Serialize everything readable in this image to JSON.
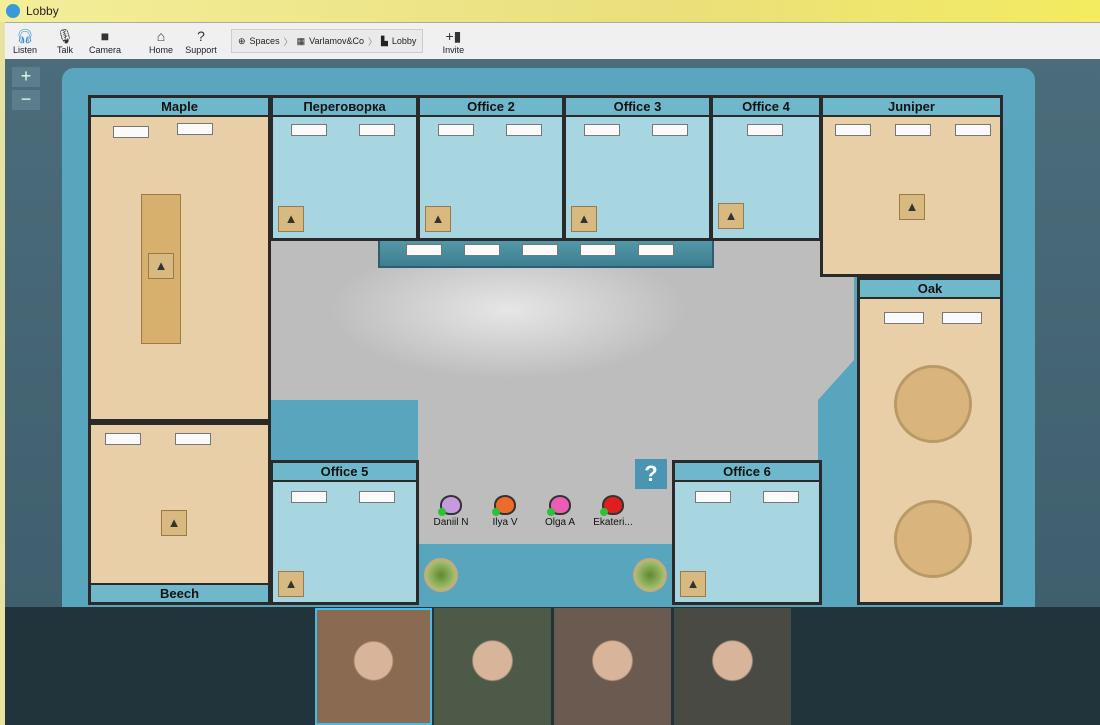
{
  "window": {
    "title": "Lobby"
  },
  "toolbar": {
    "listen": "Listen",
    "talk": "Talk",
    "camera": "Camera",
    "home": "Home",
    "support": "Support",
    "invite": "Invite"
  },
  "breadcrumb": [
    "Spaces",
    "Varlamov&Co",
    "Lobby"
  ],
  "rooms": {
    "maple": "Maple",
    "peregovorka": "Переговорка",
    "office2": "Office 2",
    "office3": "Office 3",
    "office4": "Office 4",
    "juniper": "Juniper",
    "oak": "Oak",
    "beech": "Beech",
    "office5": "Office 5",
    "office6": "Office 6"
  },
  "help": "?",
  "users": [
    {
      "name": "Daniil N",
      "color": "#c79ae0"
    },
    {
      "name": "Ilya V",
      "color": "#f06a2a"
    },
    {
      "name": "Olga A",
      "color": "#ee5cb8"
    },
    {
      "name": "Ekateri...",
      "color": "#e01e1e"
    }
  ],
  "video_tiles": [
    "#8a6a50",
    "#4e5a48",
    "#6a5a50",
    "#4a4a44"
  ]
}
